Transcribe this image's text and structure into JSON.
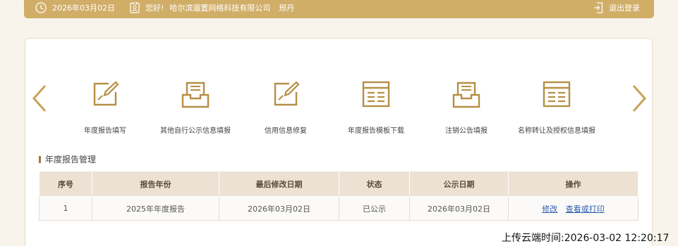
{
  "header": {
    "date": "2026年03月02日",
    "greeting": "您好!",
    "company": "哈尔滨遛置网络科技有限公司",
    "user": "邢丹",
    "logout": "退出登录"
  },
  "tiles": [
    {
      "label": "年度报告填写",
      "icon": "edit-document-icon"
    },
    {
      "label": "其他自行公示信息填报",
      "icon": "inbox-tray-icon"
    },
    {
      "label": "信用信息修复",
      "icon": "edit-document-icon"
    },
    {
      "label": "年度报告模板下载",
      "icon": "template-icon"
    },
    {
      "label": "注销公告填报",
      "icon": "inbox-tray-icon"
    },
    {
      "label": "名称转让及授权信息填报",
      "icon": "template-icon"
    }
  ],
  "section": {
    "title": "年度报告管理"
  },
  "table": {
    "headers": [
      "序号",
      "报告年份",
      "最后修改日期",
      "状态",
      "公示日期",
      "操作"
    ],
    "rows": [
      {
        "index": "1",
        "year": "2025年年度报告",
        "modified": "2026年03月02日",
        "status": "已公示",
        "published": "2026年03月02日",
        "action_edit": "修改",
        "action_view": "查看或打印"
      }
    ]
  },
  "upload_time": "上传云端时间:2026-03-02 12:20:17",
  "colors": {
    "brand": "#d1ae68",
    "icon": "#b58f44",
    "link": "#2d5fb0"
  }
}
